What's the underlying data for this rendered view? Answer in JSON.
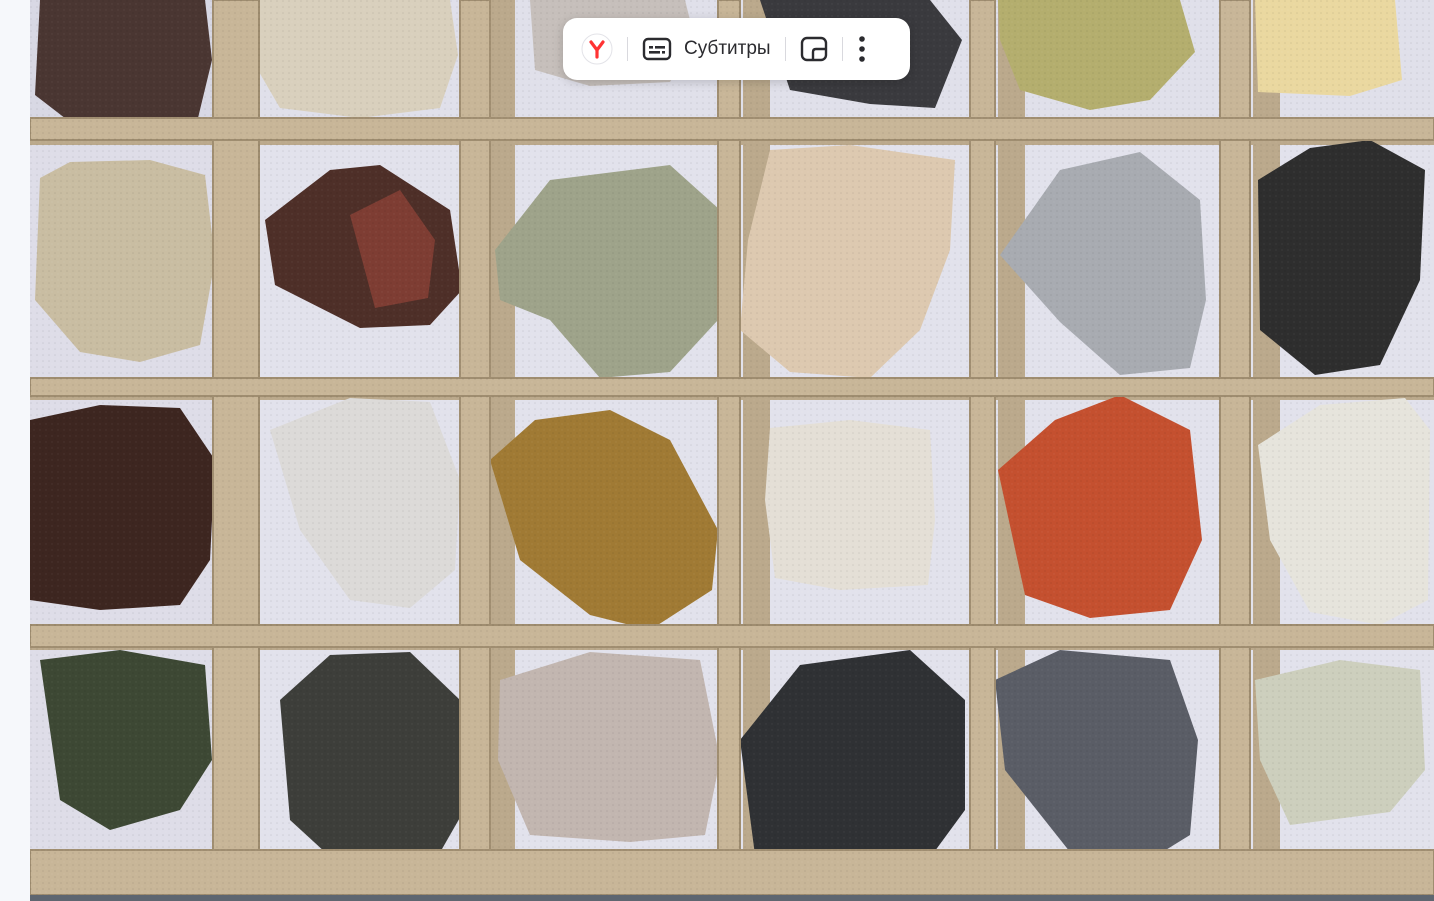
{
  "toolbar": {
    "subtitles_label": "Субтитры"
  },
  "icons": {
    "browser_logo": "yandex-logo-icon",
    "subtitles": "subtitles-icon",
    "picture_in_picture": "picture-in-picture-icon",
    "more": "more-vertical-icon"
  },
  "colors": {
    "brand_red": "#ff3333",
    "tray": "#c9b89c",
    "cell_bg": "#e4e4ee"
  },
  "video": {
    "subject": "mineral-collection-tray",
    "grid_columns": 6,
    "grid_rows": 4
  }
}
